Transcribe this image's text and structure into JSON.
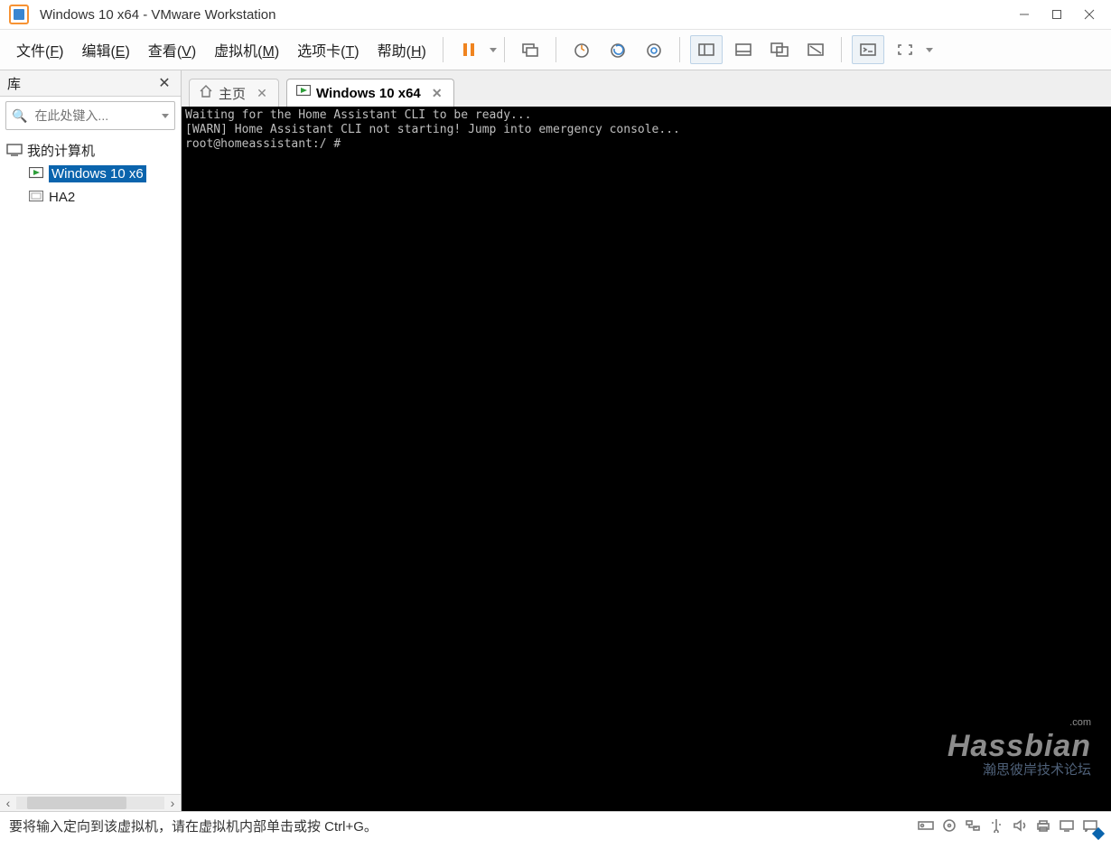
{
  "window": {
    "title": "Windows 10 x64 - VMware Workstation"
  },
  "menu": {
    "file": {
      "label": "文件",
      "hotkey": "F"
    },
    "edit": {
      "label": "编辑",
      "hotkey": "E"
    },
    "view": {
      "label": "查看",
      "hotkey": "V"
    },
    "vm": {
      "label": "虚拟机",
      "hotkey": "M"
    },
    "tabs": {
      "label": "选项卡",
      "hotkey": "T"
    },
    "help": {
      "label": "帮助",
      "hotkey": "H"
    }
  },
  "sidebar": {
    "title": "库",
    "search_placeholder": "在此处键入...",
    "root": "我的计算机",
    "items": [
      {
        "label": "Windows 10 x6",
        "running": true,
        "selected": true
      },
      {
        "label": "HA2",
        "running": false,
        "selected": false
      }
    ]
  },
  "tabs": [
    {
      "label": "主页",
      "kind": "home",
      "active": false
    },
    {
      "label": "Windows 10 x64",
      "kind": "vm",
      "running": true,
      "active": true
    }
  ],
  "console": {
    "lines": [
      "Waiting for the Home Assistant CLI to be ready...",
      "[WARN] Home Assistant CLI not starting! Jump into emergency console...",
      "root@homeassistant:/ #"
    ]
  },
  "statusbar": {
    "text": "要将输入定向到该虚拟机，请在虚拟机内部单击或按 Ctrl+G。"
  },
  "watermark": {
    "brand": "Hassbian",
    "tld": ".com",
    "tagline": "瀚思彼岸技术论坛"
  }
}
